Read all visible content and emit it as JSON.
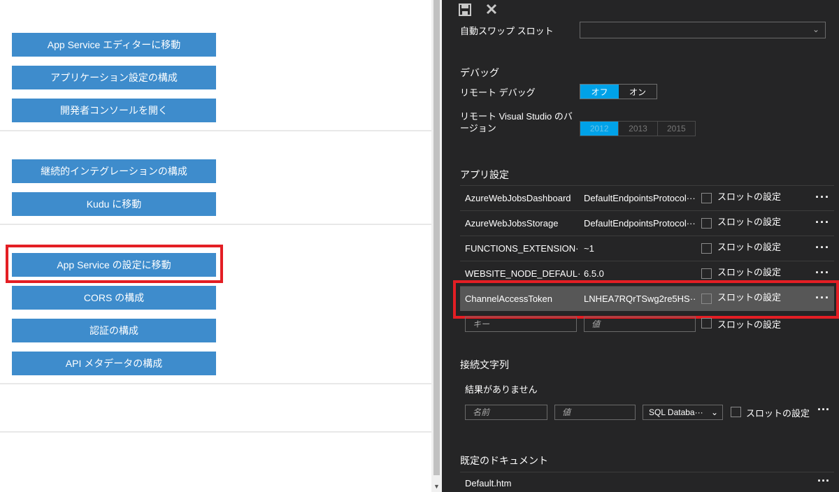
{
  "left": {
    "buttons": [
      "App Service エディターに移動",
      "アプリケーション設定の構成",
      "開発者コンソールを開く",
      "継続的インテグレーションの構成",
      "Kudu に移動",
      "App Service の設定に移動",
      "CORS の構成",
      "認証の構成",
      "API メタデータの構成"
    ]
  },
  "toolbar": {
    "save_icon": "save-icon",
    "close_icon": "close-icon"
  },
  "settings": {
    "auto_swap_label": "自動スワップ スロット",
    "debug_heading": "デバッグ",
    "remote_debug_label": "リモート デバッグ",
    "remote_debug_off": "オフ",
    "remote_debug_on": "オン",
    "remote_vs_label": "リモート Visual Studio のバージョン",
    "vs_versions": [
      "2012",
      "2013",
      "2015"
    ]
  },
  "app_settings": {
    "heading": "アプリ設定",
    "slot_label": "スロットの設定",
    "rows": [
      {
        "key": "AzureWebJobsDashboard",
        "value": "DefaultEndpointsProtocol···"
      },
      {
        "key": "AzureWebJobsStorage",
        "value": "DefaultEndpointsProtocol···"
      },
      {
        "key": "FUNCTIONS_EXTENSION···",
        "value": "~1"
      },
      {
        "key": "WEBSITE_NODE_DEFAUL···",
        "value": "6.5.0"
      },
      {
        "key": "ChannelAccessToken",
        "value": "LNHEA7RQrTSwg2re5HS···"
      }
    ],
    "key_placeholder": "キー",
    "value_placeholder": "値",
    "more": "···"
  },
  "connection_strings": {
    "heading": "接続文字列",
    "empty": "結果がありません",
    "name_placeholder": "名前",
    "value_placeholder": "値",
    "type_selected": "SQL Databa···",
    "slot_label": "スロットの設定",
    "more": "···"
  },
  "default_documents": {
    "heading": "既定のドキュメント",
    "item": "Default.htm",
    "more": "···"
  },
  "colors": {
    "button_blue": "#3e8ccc",
    "highlight_red": "#e31e24",
    "toggle_active": "#00a2e8",
    "panel_bg": "#252526"
  }
}
